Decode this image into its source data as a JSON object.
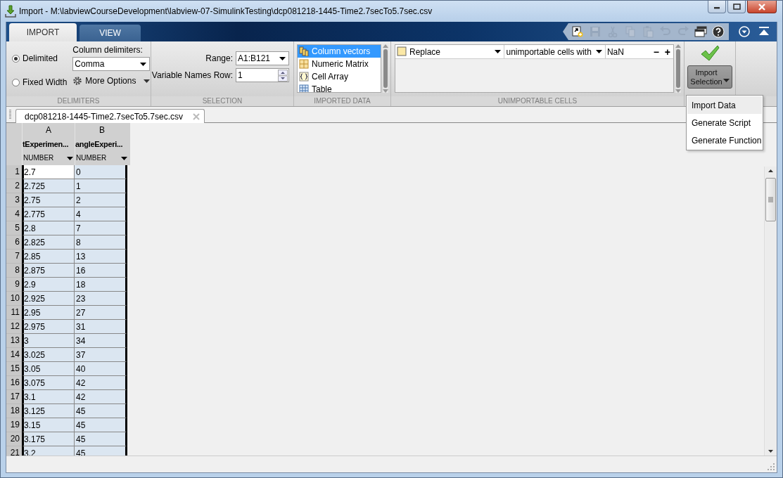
{
  "window": {
    "title": "Import - M:\\labviewCourseDevelopment\\labview-07-SimulinkTesting\\dcp081218-1445-Time2.7secTo5.7sec.csv"
  },
  "ribbon_tabs": [
    {
      "label": "IMPORT",
      "selected": true
    },
    {
      "label": "VIEW",
      "selected": false
    }
  ],
  "quick_access": [
    {
      "kind": "new",
      "disabled": false
    },
    {
      "kind": "save",
      "disabled": true
    },
    {
      "kind": "cut",
      "disabled": true
    },
    {
      "kind": "copy",
      "disabled": true
    },
    {
      "kind": "paste",
      "disabled": true
    },
    {
      "kind": "undo",
      "disabled": true
    },
    {
      "kind": "redo",
      "disabled": true
    },
    {
      "kind": "windows",
      "disabled": false
    },
    {
      "kind": "help",
      "disabled": false
    }
  ],
  "delimiters": {
    "options": [
      {
        "label": "Delimited",
        "selected": true
      },
      {
        "label": "Fixed Width",
        "selected": false
      }
    ],
    "column_delimiters_label": "Column delimiters:",
    "column_delimiters_value": "Comma",
    "more_options": "More Options",
    "section_label": "DELIMITERS"
  },
  "selection": {
    "range_label": "Range:",
    "range_value": "A1:B121",
    "variable_names_label": "Variable Names Row:",
    "variable_names_value": "1",
    "section_label": "SELECTION"
  },
  "imported_data": {
    "items": [
      {
        "kind": "columns",
        "label": "Column vectors",
        "selected": true
      },
      {
        "kind": "matrix",
        "label": "Numeric Matrix",
        "selected": false
      },
      {
        "kind": "cell",
        "label": "Cell Array",
        "selected": false
      },
      {
        "kind": "table",
        "label": "Table",
        "selected": false
      }
    ],
    "section_label": "IMPORTED DATA"
  },
  "unimportable_cells": {
    "action": "Replace",
    "target": "unimportable cells with",
    "value": "NaN",
    "remove_rule": "−",
    "add_rule": "+",
    "section_label": "UNIMPORTABLE CELLS"
  },
  "import_button": {
    "label": "Import Selection"
  },
  "import_menu": [
    {
      "label": "Import Data",
      "highlighted": true
    },
    {
      "label": "Generate Script",
      "highlighted": false
    },
    {
      "label": "Generate Function",
      "highlighted": false
    }
  ],
  "document_tab": {
    "label": "dcp081218-1445-Time2.7secTo5.7sec.csv"
  },
  "grid": {
    "columns": [
      {
        "letter": "A",
        "name": "tExperimen...",
        "type": "NUMBER"
      },
      {
        "letter": "B",
        "name": "angleExperi...",
        "type": "NUMBER"
      }
    ],
    "rows": [
      {
        "number": "1",
        "cells": [
          {
            "value": "2.7",
            "current": true
          },
          {
            "value": "0",
            "current": false
          }
        ]
      },
      {
        "number": "2",
        "cells": [
          {
            "value": "2.725",
            "current": false
          },
          {
            "value": "1",
            "current": false
          }
        ]
      },
      {
        "number": "3",
        "cells": [
          {
            "value": "2.75",
            "current": false
          },
          {
            "value": "2",
            "current": false
          }
        ]
      },
      {
        "number": "4",
        "cells": [
          {
            "value": "2.775",
            "current": false
          },
          {
            "value": "4",
            "current": false
          }
        ]
      },
      {
        "number": "5",
        "cells": [
          {
            "value": "2.8",
            "current": false
          },
          {
            "value": "7",
            "current": false
          }
        ]
      },
      {
        "number": "6",
        "cells": [
          {
            "value": "2.825",
            "current": false
          },
          {
            "value": "8",
            "current": false
          }
        ]
      },
      {
        "number": "7",
        "cells": [
          {
            "value": "2.85",
            "current": false
          },
          {
            "value": "13",
            "current": false
          }
        ]
      },
      {
        "number": "8",
        "cells": [
          {
            "value": "2.875",
            "current": false
          },
          {
            "value": "16",
            "current": false
          }
        ]
      },
      {
        "number": "9",
        "cells": [
          {
            "value": "2.9",
            "current": false
          },
          {
            "value": "18",
            "current": false
          }
        ]
      },
      {
        "number": "10",
        "cells": [
          {
            "value": "2.925",
            "current": false
          },
          {
            "value": "23",
            "current": false
          }
        ]
      },
      {
        "number": "11",
        "cells": [
          {
            "value": "2.95",
            "current": false
          },
          {
            "value": "27",
            "current": false
          }
        ]
      },
      {
        "number": "12",
        "cells": [
          {
            "value": "2.975",
            "current": false
          },
          {
            "value": "31",
            "current": false
          }
        ]
      },
      {
        "number": "13",
        "cells": [
          {
            "value": "3",
            "current": false
          },
          {
            "value": "34",
            "current": false
          }
        ]
      },
      {
        "number": "14",
        "cells": [
          {
            "value": "3.025",
            "current": false
          },
          {
            "value": "37",
            "current": false
          }
        ]
      },
      {
        "number": "15",
        "cells": [
          {
            "value": "3.05",
            "current": false
          },
          {
            "value": "40",
            "current": false
          }
        ]
      },
      {
        "number": "16",
        "cells": [
          {
            "value": "3.075",
            "current": false
          },
          {
            "value": "42",
            "current": false
          }
        ]
      },
      {
        "number": "17",
        "cells": [
          {
            "value": "3.1",
            "current": false
          },
          {
            "value": "42",
            "current": false
          }
        ]
      },
      {
        "number": "18",
        "cells": [
          {
            "value": "3.125",
            "current": false
          },
          {
            "value": "45",
            "current": false
          }
        ]
      },
      {
        "number": "19",
        "cells": [
          {
            "value": "3.15",
            "current": false
          },
          {
            "value": "45",
            "current": false
          }
        ]
      },
      {
        "number": "20",
        "cells": [
          {
            "value": "3.175",
            "current": false
          },
          {
            "value": "45",
            "current": false
          }
        ]
      },
      {
        "number": "21",
        "cells": [
          {
            "value": "3.2",
            "current": false
          },
          {
            "value": "45",
            "current": false
          }
        ]
      }
    ]
  }
}
